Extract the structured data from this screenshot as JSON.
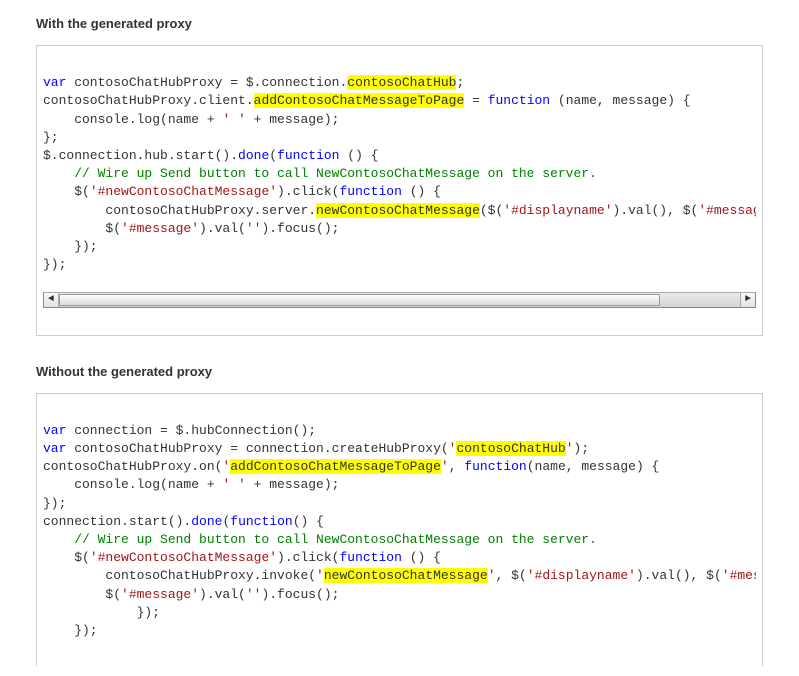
{
  "section1": {
    "title": "With the generated proxy",
    "code": {
      "kw_var1": "var",
      "line1a": " contosoChatHubProxy = $.connection.",
      "hl1": "contosoChatHub",
      "line1b": ";",
      "line2a": "contosoChatHubProxy.client.",
      "hl2": "addContosoChatMessageToPage",
      "line2b": " = ",
      "fn1": "function",
      "line2c": " (name, message) {",
      "line3a": "    console.log(name + ",
      "str1": "' '",
      "line3b": " + message);",
      "line4": "};",
      "line5a": "$.connection.hub.start().",
      "done": "done",
      "line5b": "(",
      "fn2": "function",
      "line5c": " () {",
      "comment": "    // Wire up Send button to call NewContosoChatMessage on the server.",
      "line7a": "    $(",
      "str2": "'#newContosoChatMessage'",
      "line7b": ").click(",
      "fn3": "function",
      "line7c": " () {",
      "line8a": "        contosoChatHubProxy.server.",
      "hl3": "newContosoChatMessage",
      "line8b": "($(",
      "str3": "'#displayname'",
      "line8c": ").val(), $(",
      "str4": "'#message",
      "line9a": "        $(",
      "str5": "'#message'",
      "line9b": ").val(",
      "str6": "''",
      "line9c": ").focus();",
      "line10": "    });",
      "line11": "});"
    }
  },
  "section2": {
    "title": "Without the generated proxy",
    "code": {
      "kw_var1": "var",
      "line1a": " connection = $.hubConnection();",
      "kw_var2": "var",
      "line2a": " contosoChatHubProxy = connection.createHubProxy(",
      "str1o": "'",
      "hl1": "contosoChatHub",
      "str1c": "'",
      "line2b": ");",
      "line3a": "contosoChatHubProxy.on(",
      "str2o": "'",
      "hl2": "addContosoChatMessageToPage",
      "str2c": "'",
      "line3b": ", ",
      "fn1": "function",
      "line3c": "(name, message) {",
      "line4a": "    console.log(name + ",
      "str3": "' '",
      "line4b": " + message);",
      "line5": "});",
      "line6a": "connection.start().",
      "done": "done",
      "line6b": "(",
      "fn2": "function",
      "line6c": "() {",
      "comment": "    // Wire up Send button to call NewContosoChatMessage on the server.",
      "line8a": "    $(",
      "str4": "'#newContosoChatMessage'",
      "line8b": ").click(",
      "fn3": "function",
      "line8c": " () {",
      "line9a": "        contosoChatHubProxy.invoke(",
      "str5o": "'",
      "hl3": "newContosoChatMessage",
      "str5c": "'",
      "line9b": ", $(",
      "str6": "'#displayname'",
      "line9c": ").val(), $(",
      "str7": "'#mess",
      "line10a": "        $(",
      "str8": "'#message'",
      "line10b": ").val(",
      "str9": "''",
      "line10c": ").focus();",
      "line11": "            });",
      "line12": "    });"
    }
  },
  "scrollbar": {
    "left_glyph": "◄",
    "right_glyph": "►"
  }
}
